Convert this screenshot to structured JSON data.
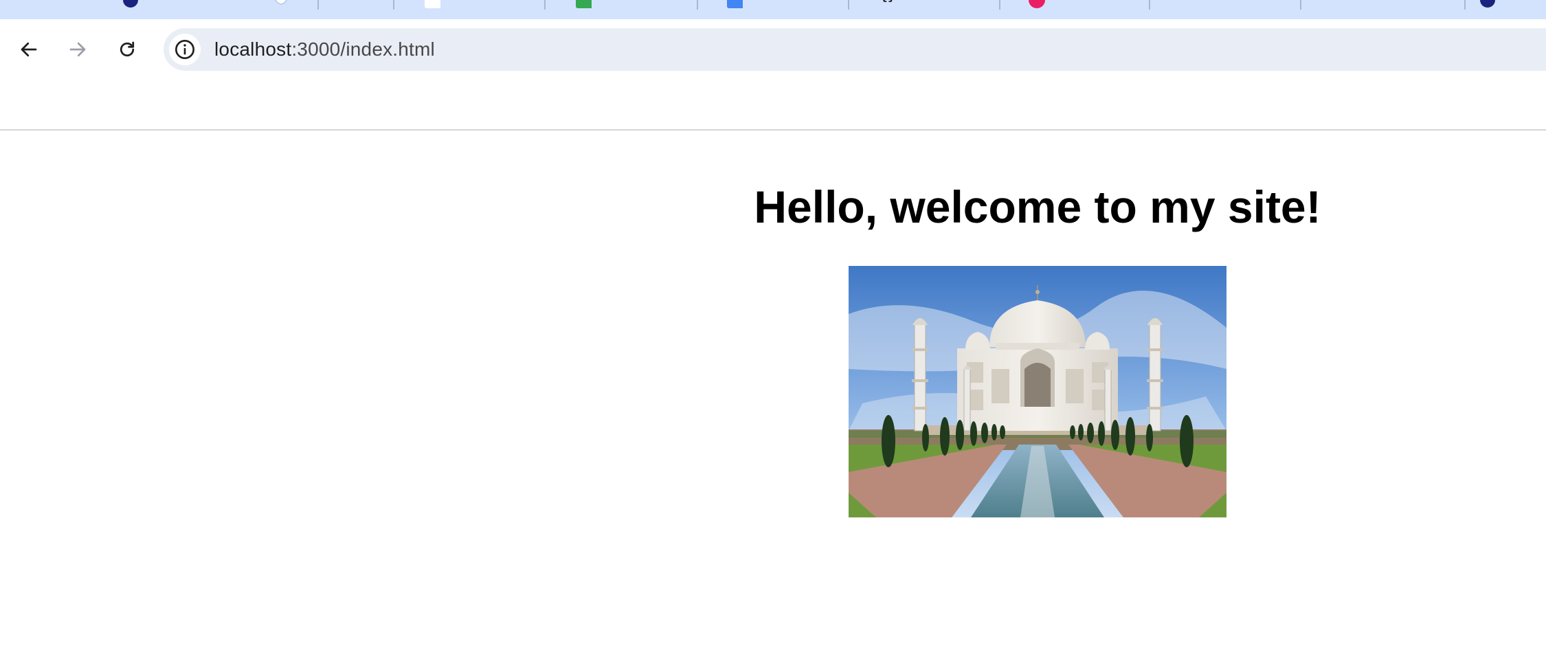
{
  "browser": {
    "url_host": "localhost",
    "url_path": ":3000/index.html",
    "tabs": [
      {
        "favicon": "blue-circle-icon",
        "color": "#1a237e"
      },
      {
        "favicon": "leaf-icon",
        "color": "#ffffff"
      },
      {
        "favicon": "white-square-icon",
        "color": "#ffffff"
      },
      {
        "favicon": "green-square-icon",
        "color": "#34a853"
      },
      {
        "favicon": "blue-square-icon",
        "color": "#4285f4"
      },
      {
        "favicon": "brackets-icon",
        "color": "#202124"
      },
      {
        "favicon": "pink-circle-icon",
        "color": "#e91e63"
      },
      {
        "favicon": "blank-icon",
        "color": "#d3e3fd"
      },
      {
        "favicon": "blank-icon",
        "color": "#d3e3fd"
      },
      {
        "favicon": "blue-circle-icon",
        "color": "#1a237e"
      }
    ]
  },
  "page": {
    "heading": "Hello, welcome to my site!",
    "image": {
      "subject": "Taj Mahal photo"
    }
  }
}
